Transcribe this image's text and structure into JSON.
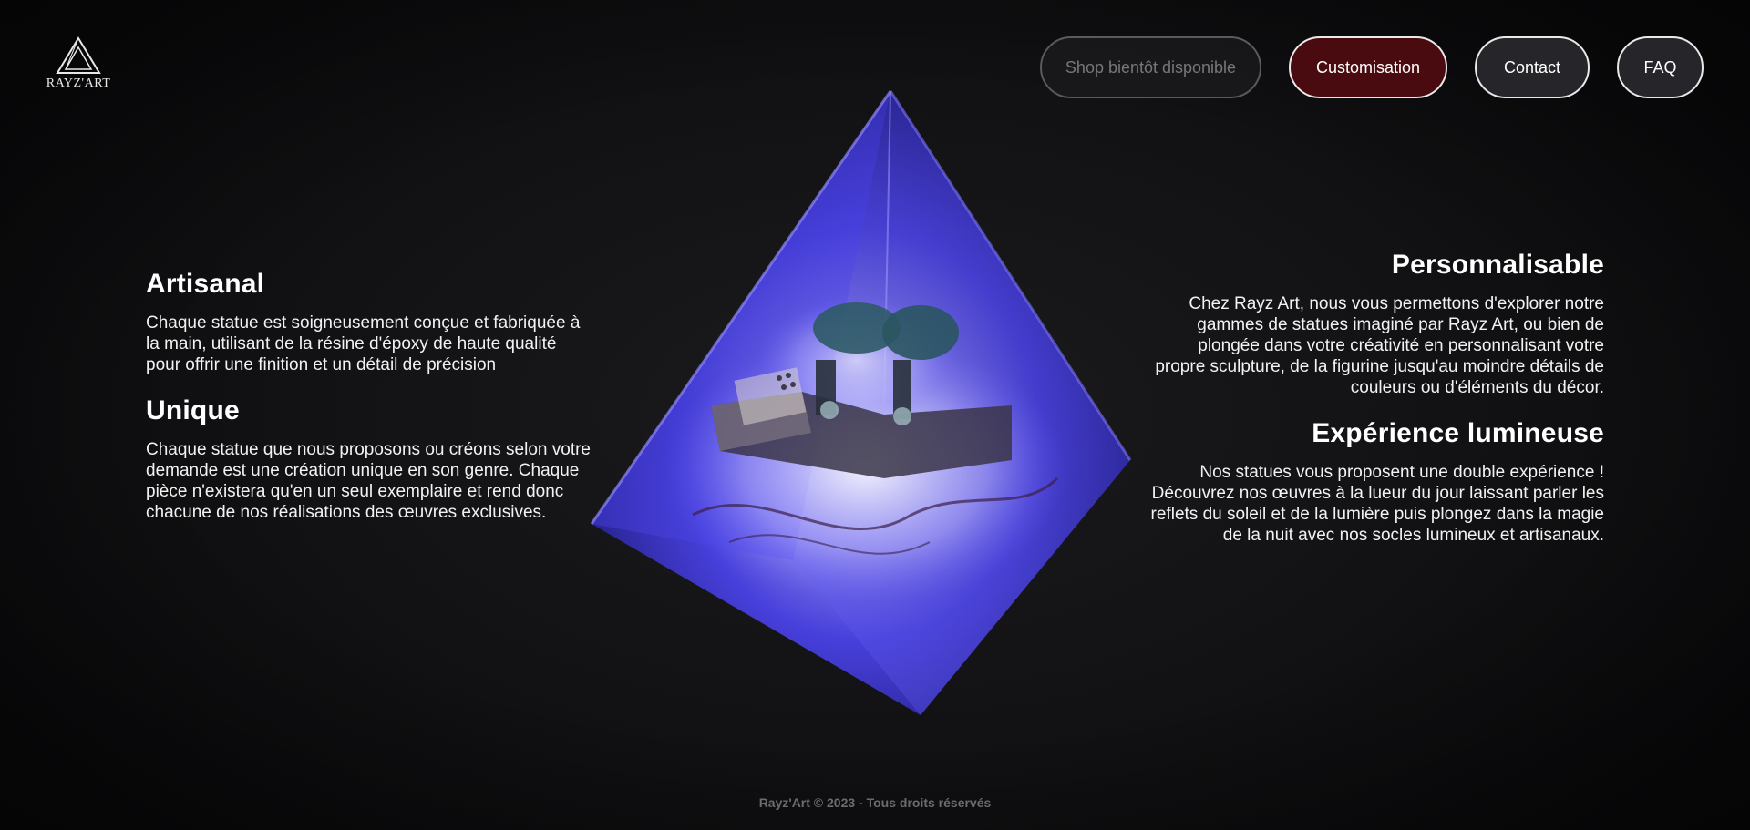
{
  "brand": {
    "logo_text": "RAYZ'ART"
  },
  "nav": {
    "shop_label": "Shop bientôt disponible",
    "customisation_label": "Customisation",
    "contact_label": "Contact",
    "faq_label": "FAQ"
  },
  "features": {
    "artisanal": {
      "title": "Artisanal",
      "text": "Chaque statue est soigneusement conçue et fabriquée à la main, utilisant de la résine d'époxy de haute qualité pour offrir une finition et un détail de précision"
    },
    "unique": {
      "title": "Unique",
      "text": "Chaque statue que nous proposons ou créons selon votre demande est une création unique en son genre. Chaque pièce n'existera qu'en un seul exemplaire et rend donc chacune de nos réalisations des œuvres exclusives."
    },
    "personnalisable": {
      "title": "Personnalisable",
      "text": "Chez Rayz Art, nous vous permettons d'explorer notre gammes de statues imaginé par Rayz Art, ou bien de plongée dans votre créativité en personnalisant votre propre sculpture, de la figurine jusqu'au moindre détails de couleurs ou d'éléments du décor."
    },
    "experience": {
      "title": "Expérience lumineuse",
      "text": "Nos statues vous proposent une double expérience ! Découvrez nos œuvres à la lueur du jour laissant parler les reflets du soleil et de la lumière puis plongez dans la magie de la nuit avec nos socles lumineux et artisanaux."
    }
  },
  "footer": {
    "copyright": "Rayz'Art © 2023 - Tous droits réservés"
  },
  "colors": {
    "customisation_bg": "#4a0b10",
    "pyramid_glow": "#5b56ff"
  }
}
